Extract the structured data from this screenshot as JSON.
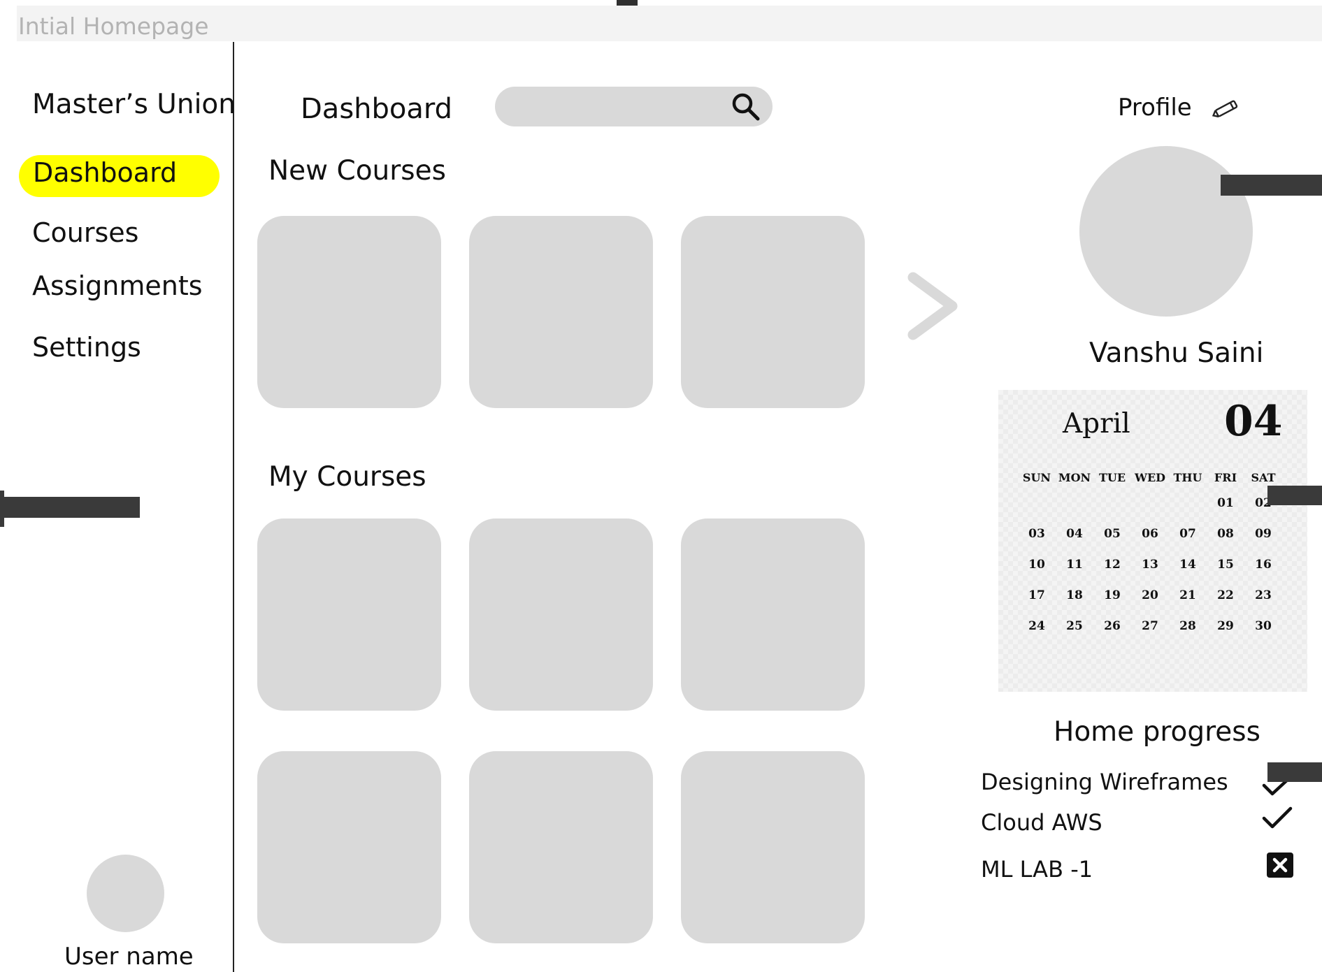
{
  "window": {
    "title": "Intial Homepage"
  },
  "sidebar": {
    "brand": "Master’s Union",
    "items": [
      {
        "label": "Dashboard",
        "active": true
      },
      {
        "label": "Courses",
        "active": false
      },
      {
        "label": "Assignments",
        "active": false
      },
      {
        "label": "Settings",
        "active": false
      }
    ],
    "user_label": "User name",
    "active_color": "#ffff00"
  },
  "header": {
    "title": "Dashboard",
    "search_placeholder": "",
    "profile_label": "Profile"
  },
  "main": {
    "new_courses_title": "New Courses",
    "my_courses_title": "My Courses"
  },
  "profile": {
    "name": "Vanshu Saini"
  },
  "calendar": {
    "month": "April",
    "day": "04",
    "weekdays": [
      "SUN",
      "MON",
      "TUE",
      "WED",
      "THU",
      "FRI",
      "SAT"
    ],
    "weeks": [
      [
        "",
        "",
        "",
        "",
        "",
        "01",
        "02"
      ],
      [
        "03",
        "04",
        "05",
        "06",
        "07",
        "08",
        "09"
      ],
      [
        "10",
        "11",
        "12",
        "13",
        "14",
        "15",
        "16"
      ],
      [
        "17",
        "18",
        "19",
        "20",
        "21",
        "22",
        "23"
      ],
      [
        "24",
        "25",
        "26",
        "27",
        "28",
        "29",
        "30"
      ]
    ]
  },
  "progress": {
    "title": "Home progress",
    "items": [
      {
        "label": "Designing Wireframes",
        "status": "check-icon"
      },
      {
        "label": "Cloud AWS",
        "status": "check-icon"
      },
      {
        "label": "ML LAB -1",
        "status": "close-box-icon"
      }
    ]
  }
}
